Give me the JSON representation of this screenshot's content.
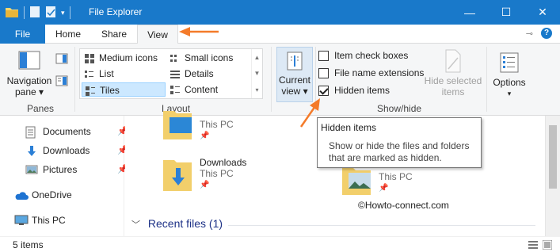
{
  "window": {
    "title": "File Explorer",
    "minimize": "—",
    "maximize": "☐",
    "close": "✕"
  },
  "tabs": {
    "file": "File",
    "home": "Home",
    "share": "Share",
    "view": "View"
  },
  "ribbon": {
    "panes": {
      "navigation_pane_line1": "Navigation",
      "navigation_pane_line2": "pane ▾",
      "group": "Panes"
    },
    "layout": {
      "items": [
        "Medium icons",
        "Small icons",
        "List",
        "Details",
        "Tiles",
        "Content"
      ],
      "selected": "Tiles",
      "group": "Layout"
    },
    "current_view": {
      "line1": "Current",
      "line2": "view ▾"
    },
    "show_hide": {
      "item_check_boxes": "Item check boxes",
      "file_name_extensions": "File name extensions",
      "hidden_items": "Hidden items",
      "item_check_boxes_checked": false,
      "file_name_extensions_checked": false,
      "hidden_items_checked": true,
      "hide_selected_line1": "Hide selected",
      "hide_selected_line2": "items",
      "group": "Show/hide"
    },
    "options": {
      "label": "Options",
      "caret": "▾"
    }
  },
  "nav": {
    "documents": "Documents",
    "downloads": "Downloads",
    "pictures": "Pictures",
    "onedrive": "OneDrive",
    "this_pc": "This PC"
  },
  "content": {
    "tile1_sub": "This PC",
    "downloads_name": "Downloads",
    "downloads_sub": "This PC",
    "pictures_sub": "This PC",
    "recent_files": "Recent files (1)",
    "watermark": "©Howto-connect.com"
  },
  "tooltip": {
    "title": "Hidden items",
    "body": "Show or hide the files and folders that are marked as hidden."
  },
  "status": {
    "items": "5 items"
  },
  "colors": {
    "accent": "#1979ca",
    "arrow": "#f47b2a",
    "selected_bg": "#cce8ff",
    "link": "#1e3287"
  }
}
